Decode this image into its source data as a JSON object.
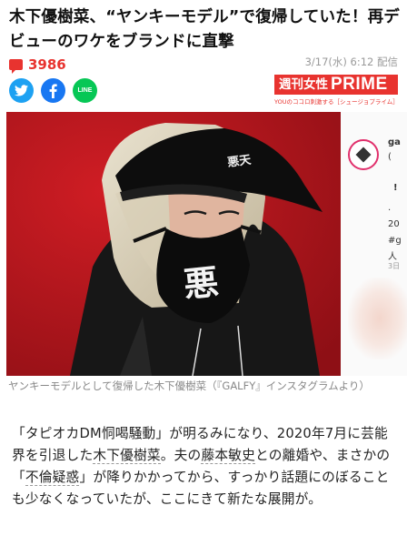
{
  "article": {
    "headline": "木下優樹菜、“ヤンキーモデル”で復帰していた！再デビューのワケをブランドに直撃",
    "comment_count": "3986",
    "date": "3/17(水) 6:12 配信"
  },
  "share": {
    "twitter_icon": "twitter-icon",
    "facebook_icon": "facebook-icon",
    "line_icon": "line-icon",
    "line_label": "LINE"
  },
  "publisher": {
    "name_jp": "週刊女性",
    "name_en": "PRIME",
    "tagline": "YOUのココロ刺激する［シュージョプライム］",
    "brand_color": "#e8332f"
  },
  "photo": {
    "cap_text": "悪天",
    "mask_text": "悪",
    "side_texts": [
      "ga",
      "(",
      "!",
      ".",
      "20",
      "#g",
      "人",
      "3日"
    ]
  },
  "caption": "ヤンキーモデルとして復帰した木下優樹菜（『GALFY』インスタグラムより）",
  "body": {
    "p1": "「タピオカDM恫喝騒動」が明るみになり、2020年7月に芸能界を引退した",
    "link1": "木下優樹菜",
    "p2": "。夫の",
    "link2": "藤本敏史",
    "p3": "との離婚や、まさかの「",
    "link3": "不倫疑惑",
    "p4": "」が降りかかってから、すっかり話題にのぼることも少なくなっていたが、ここにきて新たな展開が。"
  }
}
